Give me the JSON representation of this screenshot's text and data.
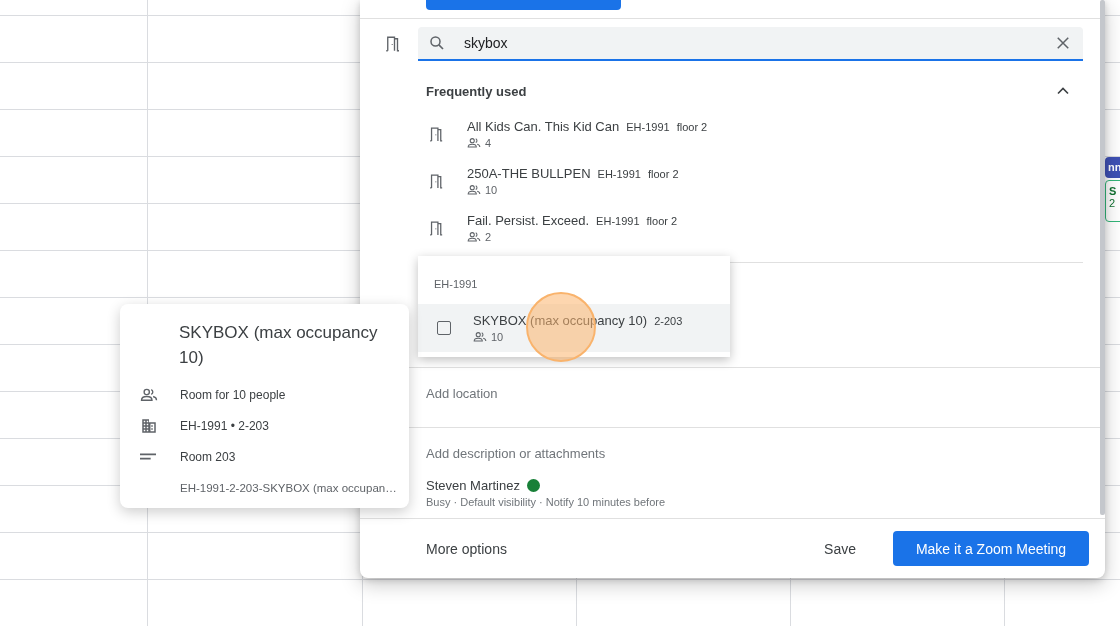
{
  "calendar_events": [
    {
      "kind": "filled",
      "title": "nn"
    },
    {
      "kind": "outlined",
      "title": "S",
      "detail": "2"
    }
  ],
  "event_dialog": {
    "search": {
      "value": "skybox"
    },
    "frequently_used": {
      "title": "Frequently used",
      "expanded": true,
      "rooms": [
        {
          "name": "All Kids Can. This Kid Can",
          "building": "EH-1991",
          "floor": "floor 2",
          "capacity": "4"
        },
        {
          "name": "250A-THE BULLPEN",
          "building": "EH-1991",
          "floor": "floor 2",
          "capacity": "10"
        },
        {
          "name": "Fail. Persist. Exceed.",
          "building": "EH-1991",
          "floor": "floor 2",
          "capacity": "2"
        }
      ]
    },
    "location": {
      "placeholder": "Add location"
    },
    "description": {
      "placeholder": "Add description or attachments"
    },
    "organizer": {
      "name": "Steven Martinez",
      "color": "#188038",
      "details": "Busy · Default visibility · Notify 10 minutes before"
    },
    "footer": {
      "more_options": "More options",
      "save": "Save",
      "primary": "Make it a Zoom Meeting"
    }
  },
  "room_dropdown": {
    "group": "EH-1991",
    "options": [
      {
        "name": "SKYBOX (max occupancy 10)",
        "code": "2-203",
        "capacity": "10",
        "checked": false,
        "selected": true
      }
    ]
  },
  "room_card": {
    "title": "SKYBOX (max occupancy 10)",
    "capacity": "Room for 10 people",
    "location": "EH-1991 • 2-203",
    "description": "Room 203",
    "resource_id": "EH-1991-2-203-SKYBOX (max occupan…"
  }
}
